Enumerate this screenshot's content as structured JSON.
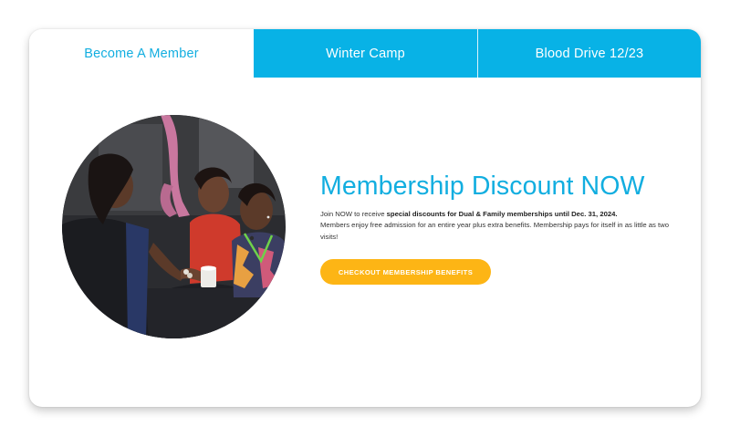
{
  "tabs": [
    {
      "label": "Become A Member",
      "active": true
    },
    {
      "label": "Winter Camp",
      "active": false
    },
    {
      "label": "Blood Drive 12/23",
      "active": false
    }
  ],
  "colors": {
    "accent": "#12aee0",
    "tab_bg": "#08b2e6",
    "cta": "#fdb515"
  },
  "hero": {
    "image": "people-socializing-photo",
    "headline": "Membership Discount NOW",
    "intro": "Join NOW to receive ",
    "intro_bold": "special discounts for Dual & Family memberships until Dec. 31, 2024.",
    "details": "Members enjoy free admission for an entire year plus extra benefits. Membership pays for itself in as little as two visits!",
    "cta_label": "CHECKOUT MEMBERSHIP BENEFITS"
  }
}
